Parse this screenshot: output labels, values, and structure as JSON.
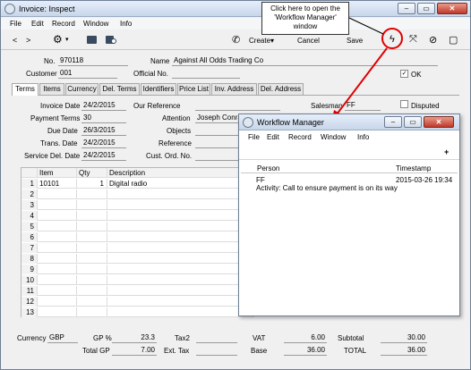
{
  "main_window": {
    "title": "Invoice: Inspect",
    "menu": [
      "File",
      "Edit",
      "Record",
      "Window",
      "Info"
    ],
    "nav_prev": "<",
    "nav_next": ">",
    "toolbar": {
      "create_label": "Create",
      "create_arrow": "▾",
      "cancel_label": "Cancel",
      "save_label": "Save"
    }
  },
  "callout": {
    "text": "Click here to open the 'Workflow Manager' window"
  },
  "header": {
    "no_label": "No.",
    "no_value": "970118",
    "name_label": "Name",
    "name_value": "Against All Odds Trading Co",
    "customer_label": "Customer",
    "customer_value": "001",
    "official_label": "Official No.",
    "official_value": "",
    "ok_label": "OK",
    "ok_checked": true
  },
  "tabs": [
    "Terms",
    "Items",
    "Currency",
    "Del. Terms",
    "Identifiers",
    "Price List",
    "Inv. Address",
    "Del. Address"
  ],
  "terms": {
    "invoice_date_label": "Invoice Date",
    "invoice_date": "24/2/2015",
    "payment_terms_label": "Payment Terms",
    "payment_terms": "30",
    "due_date_label": "Due Date",
    "due_date": "26/3/2015",
    "trans_date_label": "Trans. Date",
    "trans_date": "24/2/2015",
    "service_del_label": "Service Del. Date",
    "service_del": "24/2/2015",
    "our_ref_label": "Our Reference",
    "our_ref": "",
    "attention_label": "Attention",
    "attention": "Joseph Conrad",
    "objects_label": "Objects",
    "objects": "",
    "reference_label": "Reference",
    "reference": "",
    "cust_ord_label": "Cust. Ord. No.",
    "cust_ord": "",
    "salesman_label": "Salesman",
    "salesman": "FF",
    "disputed_label": "Disputed"
  },
  "items": {
    "columns": [
      "Item",
      "Qty",
      "Description"
    ],
    "rows": [
      {
        "n": "1",
        "item": "10101",
        "qty": "1",
        "desc": "Digital radio"
      },
      {
        "n": "2",
        "item": "",
        "qty": "",
        "desc": ""
      },
      {
        "n": "3",
        "item": "",
        "qty": "",
        "desc": ""
      },
      {
        "n": "4",
        "item": "",
        "qty": "",
        "desc": ""
      },
      {
        "n": "5",
        "item": "",
        "qty": "",
        "desc": ""
      },
      {
        "n": "6",
        "item": "",
        "qty": "",
        "desc": ""
      },
      {
        "n": "7",
        "item": "",
        "qty": "",
        "desc": ""
      },
      {
        "n": "8",
        "item": "",
        "qty": "",
        "desc": ""
      },
      {
        "n": "9",
        "item": "",
        "qty": "",
        "desc": ""
      },
      {
        "n": "10",
        "item": "",
        "qty": "",
        "desc": ""
      },
      {
        "n": "11",
        "item": "",
        "qty": "",
        "desc": ""
      },
      {
        "n": "12",
        "item": "",
        "qty": "",
        "desc": ""
      },
      {
        "n": "13",
        "item": "",
        "qty": "",
        "desc": ""
      }
    ]
  },
  "footer": {
    "currency_label": "Currency",
    "currency": "GBP",
    "gp_pct_label": "GP %",
    "gp_pct": "23.3",
    "total_gp_label": "Total GP",
    "total_gp": "7.00",
    "tax2_label": "Tax2",
    "tax2": "",
    "ext_tax_label": "Ext. Tax",
    "ext_tax": "",
    "vat_label": "VAT",
    "vat": "6.00",
    "base_label": "Base",
    "base": "36.00",
    "subtotal_label": "Subtotal",
    "subtotal": "30.00",
    "total_label": "TOTAL",
    "total": "36.00"
  },
  "workflow": {
    "title": "Workflow Manager",
    "menu": [
      "File",
      "Edit",
      "Record",
      "Window",
      "Info"
    ],
    "add": "+",
    "columns": [
      "Person",
      "Timestamp"
    ],
    "rows": [
      {
        "person": "FF",
        "activity": "Activity: Call to ensure payment is on its way",
        "timestamp": "2015-03-26 19:34"
      }
    ]
  }
}
